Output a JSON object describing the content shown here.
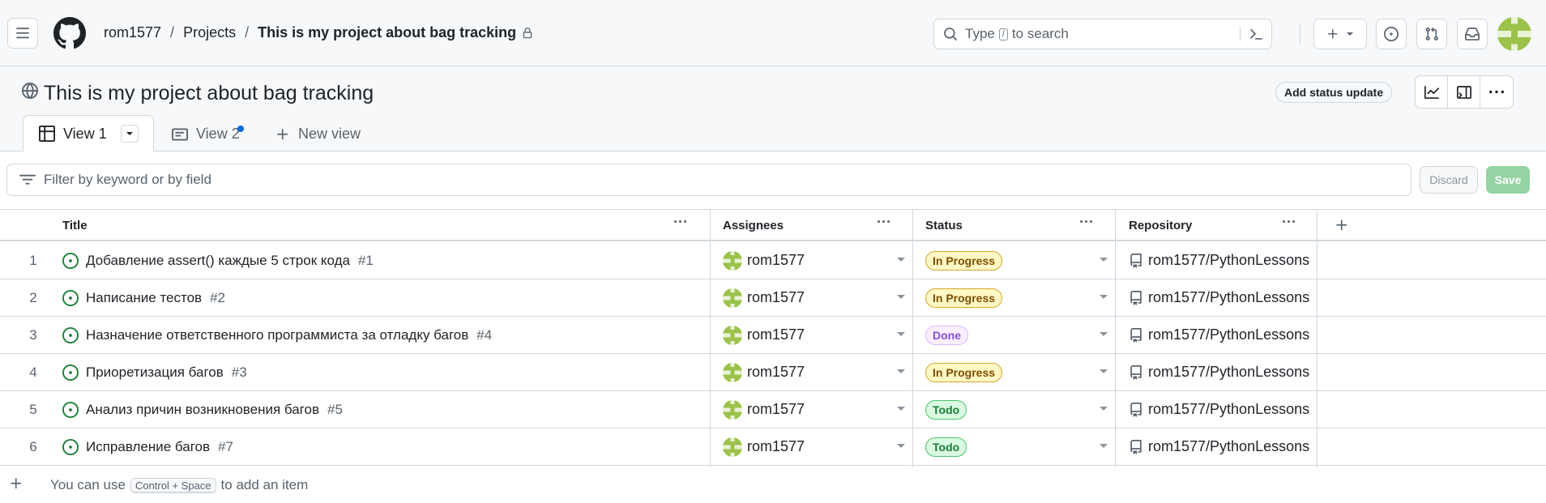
{
  "header": {
    "breadcrumb": {
      "owner": "rom1577",
      "projects": "Projects",
      "current": "This is my project about bag tracking"
    },
    "search": {
      "prefix": "Type",
      "slash": "/",
      "suffix": "to search"
    }
  },
  "project": {
    "title": "This is my project about bag tracking",
    "status_update_label": "Add status update"
  },
  "tabs": [
    {
      "label": "View 1"
    },
    {
      "label": "View 2"
    },
    {
      "label": "New view"
    }
  ],
  "filter": {
    "placeholder": "Filter by keyword or by field",
    "discard_label": "Discard",
    "save_label": "Save"
  },
  "columns": {
    "title": "Title",
    "assignees": "Assignees",
    "status": "Status",
    "repository": "Repository"
  },
  "rows": [
    {
      "n": "1",
      "title": "Добавление assert() каждые 5 строк кода",
      "num": "#1",
      "assignee": "rom1577",
      "status": "In Progress",
      "repo": "rom1577/PythonLessons"
    },
    {
      "n": "2",
      "title": "Написание тестов",
      "num": "#2",
      "assignee": "rom1577",
      "status": "In Progress",
      "repo": "rom1577/PythonLessons"
    },
    {
      "n": "3",
      "title": "Назначение ответственного программиста за отладку багов",
      "num": "#4",
      "assignee": "rom1577",
      "status": "Done",
      "repo": "rom1577/PythonLessons"
    },
    {
      "n": "4",
      "title": "Приоретизация багов",
      "num": "#3",
      "assignee": "rom1577",
      "status": "In Progress",
      "repo": "rom1577/PythonLessons"
    },
    {
      "n": "5",
      "title": "Анализ причин возникновения багов",
      "num": "#5",
      "assignee": "rom1577",
      "status": "Todo",
      "repo": "rom1577/PythonLessons"
    },
    {
      "n": "6",
      "title": "Исправление багов",
      "num": "#7",
      "assignee": "rom1577",
      "status": "Todo",
      "repo": "rom1577/PythonLessons"
    }
  ],
  "add_item": {
    "prefix": "You can use",
    "shortcut": "Control + Space",
    "suffix": "to add an item"
  },
  "colors": {
    "accent_blue": "#0969da",
    "open_issue_green": "#1a7f37",
    "in_progress_yellow": "#fff8c5",
    "done_purple": "#fbefff",
    "todo_green": "#dafbe1",
    "save_green": "#94d3a2"
  }
}
